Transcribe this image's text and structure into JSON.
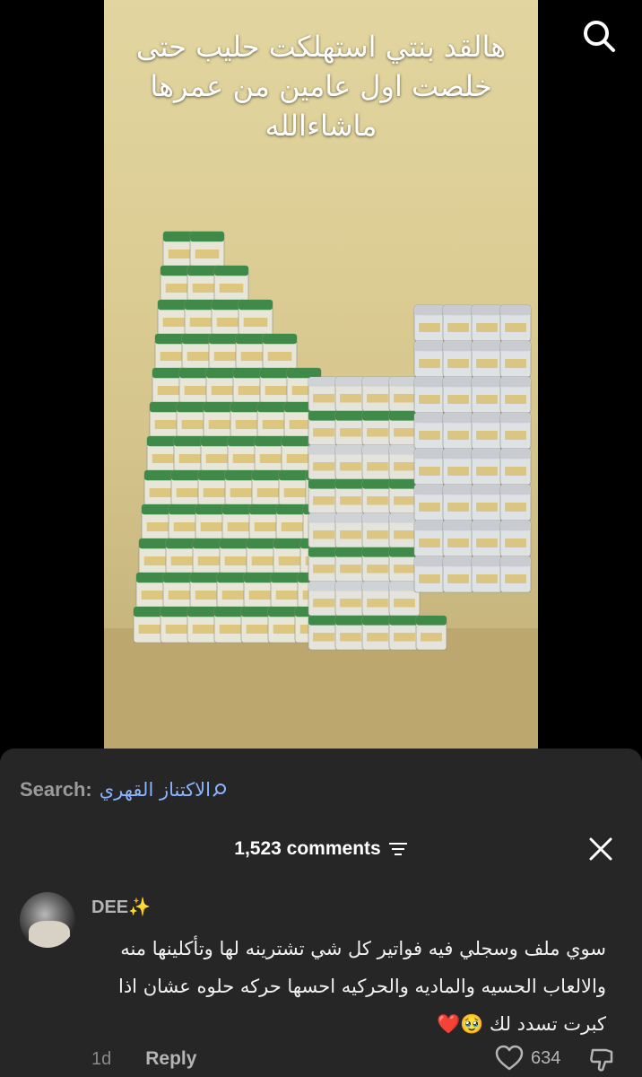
{
  "video": {
    "caption_lines": [
      "هالقد بنتي استهلكت حليب حتى",
      "خلصت اول عامين من عمرها",
      "ماشاءالله"
    ]
  },
  "search": {
    "prefix": "Search:",
    "term": "الاكتناز القهري"
  },
  "comments": {
    "count_label": "1,523 comments"
  },
  "comment": {
    "username": "DEE✨",
    "text": "سوي ملف وسجلي فيه فواتير كل شي تشترينه لها وتأكلينها منه والالعاب الحسيه والماديه والحركيه احسها حركه حلوه عشان اذا كبرت تسدد لك 🥹❤️",
    "age": "1d",
    "reply_label": "Reply",
    "likes": "634"
  },
  "colors": {
    "panel_bg": "#262626",
    "link_blue": "#8ab4ff",
    "muted": "#b4b4b4"
  }
}
